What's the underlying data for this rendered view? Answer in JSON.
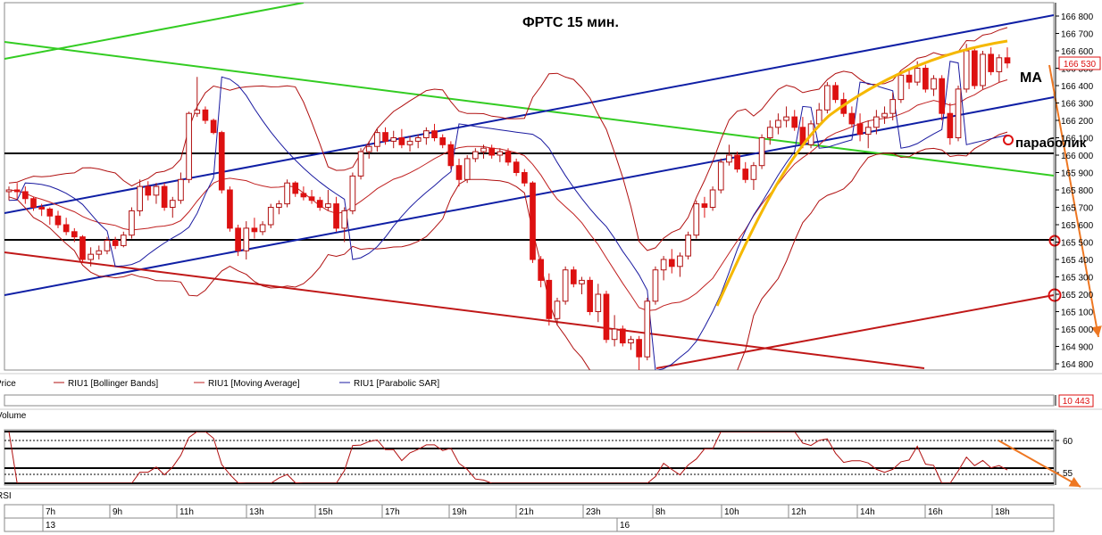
{
  "annotations": {
    "title": "ФРТС   15 мин.",
    "ma_label": "MA",
    "sar_label": "параболик"
  },
  "price_axis": {
    "ticks": [
      "166 800",
      "166 700",
      "166 600",
      "166 500",
      "166 400",
      "166 300",
      "166 200",
      "166 100",
      "166 000",
      "165 900",
      "165 800",
      "165 700",
      "165 600",
      "165 500",
      "165 400",
      "165 300",
      "165 200",
      "165 100",
      "165 000",
      "164 900",
      "164 800"
    ],
    "current_price": "166 530"
  },
  "legend": {
    "price": "Price",
    "bollinger": "RIU1 [Bollinger Bands]",
    "ma": "RIU1 [Moving Average]",
    "sar": "RIU1 [Parabolic SAR]"
  },
  "volume": {
    "label": "Volume",
    "value": "10 443"
  },
  "rsi": {
    "label": "RSI",
    "ticks": [
      "60",
      "55"
    ]
  },
  "time_axis": {
    "hours": [
      "7h",
      "9h",
      "11h",
      "13h",
      "15h",
      "17h",
      "19h",
      "21h",
      "23h",
      "8h",
      "10h",
      "12h",
      "14h",
      "16h",
      "18h"
    ],
    "days": [
      "13",
      "16"
    ]
  },
  "colors": {
    "bull_candle": "#ffffff",
    "bear_candle": "#dd1111",
    "bollinger": "#b01010",
    "moving_average": "#c02020",
    "parabolic_sar": "#1a1aa0",
    "channel_blue": "#0f1fa5",
    "trend_green": "#33cc22",
    "trend_red": "#c01818",
    "forecast_orange": "#ee7722",
    "ma_arc": "#f5b800"
  },
  "chart_data": {
    "type": "candlestick",
    "instrument": "RIU1",
    "timeframe": "15 мин.",
    "ylim": [
      164750,
      166870
    ],
    "candles": [
      {
        "o": 165790,
        "h": 165820,
        "l": 165740,
        "c": 165800
      },
      {
        "o": 165800,
        "h": 165840,
        "l": 165750,
        "c": 165790
      },
      {
        "o": 165790,
        "h": 165820,
        "l": 165720,
        "c": 165750
      },
      {
        "o": 165750,
        "h": 165760,
        "l": 165680,
        "c": 165700
      },
      {
        "o": 165700,
        "h": 165720,
        "l": 165650,
        "c": 165690
      },
      {
        "o": 165690,
        "h": 165700,
        "l": 165600,
        "c": 165650
      },
      {
        "o": 165650,
        "h": 165680,
        "l": 165580,
        "c": 165600
      },
      {
        "o": 165600,
        "h": 165640,
        "l": 165540,
        "c": 165560
      },
      {
        "o": 165560,
        "h": 165580,
        "l": 165500,
        "c": 165530
      },
      {
        "o": 165530,
        "h": 165540,
        "l": 165380,
        "c": 165400
      },
      {
        "o": 165400,
        "h": 165470,
        "l": 165360,
        "c": 165430
      },
      {
        "o": 165430,
        "h": 165480,
        "l": 165400,
        "c": 165450
      },
      {
        "o": 165450,
        "h": 165530,
        "l": 165430,
        "c": 165510
      },
      {
        "o": 165510,
        "h": 165530,
        "l": 165460,
        "c": 165480
      },
      {
        "o": 165480,
        "h": 165560,
        "l": 165470,
        "c": 165540
      },
      {
        "o": 165540,
        "h": 165700,
        "l": 165520,
        "c": 165680
      },
      {
        "o": 165680,
        "h": 165860,
        "l": 165650,
        "c": 165820
      },
      {
        "o": 165820,
        "h": 165850,
        "l": 165740,
        "c": 165770
      },
      {
        "o": 165770,
        "h": 165840,
        "l": 165720,
        "c": 165820
      },
      {
        "o": 165820,
        "h": 165840,
        "l": 165680,
        "c": 165700
      },
      {
        "o": 165700,
        "h": 165760,
        "l": 165640,
        "c": 165740
      },
      {
        "o": 165740,
        "h": 165900,
        "l": 165720,
        "c": 165860
      },
      {
        "o": 165860,
        "h": 166250,
        "l": 165840,
        "c": 166240
      },
      {
        "o": 166240,
        "h": 166450,
        "l": 166220,
        "c": 166260
      },
      {
        "o": 166260,
        "h": 166280,
        "l": 166180,
        "c": 166200
      },
      {
        "o": 166200,
        "h": 166210,
        "l": 166120,
        "c": 166130
      },
      {
        "o": 166130,
        "h": 166140,
        "l": 165780,
        "c": 165800
      },
      {
        "o": 165800,
        "h": 165820,
        "l": 165560,
        "c": 165580
      },
      {
        "o": 165580,
        "h": 165600,
        "l": 165420,
        "c": 165450
      },
      {
        "o": 165450,
        "h": 165620,
        "l": 165400,
        "c": 165580
      },
      {
        "o": 165580,
        "h": 165640,
        "l": 165520,
        "c": 165560
      },
      {
        "o": 165560,
        "h": 165620,
        "l": 165540,
        "c": 165600
      },
      {
        "o": 165600,
        "h": 165720,
        "l": 165580,
        "c": 165700
      },
      {
        "o": 165700,
        "h": 165740,
        "l": 165660,
        "c": 165720
      },
      {
        "o": 165720,
        "h": 165860,
        "l": 165700,
        "c": 165840
      },
      {
        "o": 165840,
        "h": 165850,
        "l": 165760,
        "c": 165780
      },
      {
        "o": 165780,
        "h": 165820,
        "l": 165740,
        "c": 165760
      },
      {
        "o": 165760,
        "h": 165800,
        "l": 165720,
        "c": 165740
      },
      {
        "o": 165740,
        "h": 165760,
        "l": 165680,
        "c": 165700
      },
      {
        "o": 165700,
        "h": 165800,
        "l": 165680,
        "c": 165720
      },
      {
        "o": 165720,
        "h": 165760,
        "l": 165560,
        "c": 165580
      },
      {
        "o": 165580,
        "h": 165700,
        "l": 165500,
        "c": 165680
      },
      {
        "o": 165680,
        "h": 165900,
        "l": 165660,
        "c": 165880
      },
      {
        "o": 165880,
        "h": 166040,
        "l": 165860,
        "c": 166020
      },
      {
        "o": 166020,
        "h": 166080,
        "l": 165980,
        "c": 166050
      },
      {
        "o": 166050,
        "h": 166150,
        "l": 166020,
        "c": 166130
      },
      {
        "o": 166130,
        "h": 166160,
        "l": 166060,
        "c": 166080
      },
      {
        "o": 166080,
        "h": 166140,
        "l": 166040,
        "c": 166100
      },
      {
        "o": 166100,
        "h": 166150,
        "l": 166040,
        "c": 166060
      },
      {
        "o": 166060,
        "h": 166110,
        "l": 166020,
        "c": 166080
      },
      {
        "o": 166080,
        "h": 166120,
        "l": 166040,
        "c": 166100
      },
      {
        "o": 166100,
        "h": 166160,
        "l": 166060,
        "c": 166140
      },
      {
        "o": 166140,
        "h": 166180,
        "l": 166080,
        "c": 166100
      },
      {
        "o": 166100,
        "h": 166120,
        "l": 166040,
        "c": 166060
      },
      {
        "o": 166060,
        "h": 166080,
        "l": 165920,
        "c": 165940
      },
      {
        "o": 165940,
        "h": 165980,
        "l": 165820,
        "c": 165860
      },
      {
        "o": 165860,
        "h": 166000,
        "l": 165840,
        "c": 165980
      },
      {
        "o": 165980,
        "h": 166040,
        "l": 165960,
        "c": 166020
      },
      {
        "o": 166020,
        "h": 166060,
        "l": 165980,
        "c": 166040
      },
      {
        "o": 166040,
        "h": 166060,
        "l": 165980,
        "c": 166000
      },
      {
        "o": 166000,
        "h": 166040,
        "l": 165960,
        "c": 166020
      },
      {
        "o": 166020,
        "h": 166040,
        "l": 165940,
        "c": 165960
      },
      {
        "o": 165960,
        "h": 165980,
        "l": 165880,
        "c": 165900
      },
      {
        "o": 165900,
        "h": 165920,
        "l": 165820,
        "c": 165840
      },
      {
        "o": 165840,
        "h": 165850,
        "l": 165380,
        "c": 165400
      },
      {
        "o": 165400,
        "h": 165420,
        "l": 165240,
        "c": 165280
      },
      {
        "o": 165280,
        "h": 165320,
        "l": 165020,
        "c": 165060
      },
      {
        "o": 165060,
        "h": 165180,
        "l": 165020,
        "c": 165160
      },
      {
        "o": 165160,
        "h": 165360,
        "l": 165140,
        "c": 165340
      },
      {
        "o": 165340,
        "h": 165360,
        "l": 165240,
        "c": 165260
      },
      {
        "o": 165260,
        "h": 165300,
        "l": 165200,
        "c": 165280
      },
      {
        "o": 165280,
        "h": 165300,
        "l": 165080,
        "c": 165100
      },
      {
        "o": 165100,
        "h": 165260,
        "l": 165040,
        "c": 165200
      },
      {
        "o": 165200,
        "h": 165220,
        "l": 164920,
        "c": 164940
      },
      {
        "o": 164940,
        "h": 165080,
        "l": 164900,
        "c": 165000
      },
      {
        "o": 165000,
        "h": 165020,
        "l": 164900,
        "c": 164920
      },
      {
        "o": 164920,
        "h": 164960,
        "l": 164880,
        "c": 164940
      },
      {
        "o": 164940,
        "h": 164960,
        "l": 164760,
        "c": 164840
      },
      {
        "o": 164840,
        "h": 165180,
        "l": 164820,
        "c": 165160
      },
      {
        "o": 165160,
        "h": 165360,
        "l": 165140,
        "c": 165340
      },
      {
        "o": 165340,
        "h": 165420,
        "l": 165280,
        "c": 165400
      },
      {
        "o": 165400,
        "h": 165460,
        "l": 165320,
        "c": 165360
      },
      {
        "o": 165360,
        "h": 165440,
        "l": 165300,
        "c": 165420
      },
      {
        "o": 165420,
        "h": 165560,
        "l": 165400,
        "c": 165540
      },
      {
        "o": 165540,
        "h": 165740,
        "l": 165520,
        "c": 165720
      },
      {
        "o": 165720,
        "h": 165760,
        "l": 165640,
        "c": 165700
      },
      {
        "o": 165700,
        "h": 165820,
        "l": 165680,
        "c": 165800
      },
      {
        "o": 165800,
        "h": 165980,
        "l": 165780,
        "c": 165960
      },
      {
        "o": 165960,
        "h": 166060,
        "l": 165940,
        "c": 166000
      },
      {
        "o": 166000,
        "h": 166020,
        "l": 165900,
        "c": 165920
      },
      {
        "o": 165920,
        "h": 165960,
        "l": 165840,
        "c": 165860
      },
      {
        "o": 165860,
        "h": 165960,
        "l": 165800,
        "c": 165940
      },
      {
        "o": 165940,
        "h": 166120,
        "l": 165920,
        "c": 166100
      },
      {
        "o": 166100,
        "h": 166200,
        "l": 166060,
        "c": 166160
      },
      {
        "o": 166160,
        "h": 166240,
        "l": 166120,
        "c": 166200
      },
      {
        "o": 166200,
        "h": 166280,
        "l": 166160,
        "c": 166220
      },
      {
        "o": 166220,
        "h": 166260,
        "l": 166140,
        "c": 166160
      },
      {
        "o": 166160,
        "h": 166220,
        "l": 166040,
        "c": 166060
      },
      {
        "o": 166060,
        "h": 166200,
        "l": 166040,
        "c": 166180
      },
      {
        "o": 166180,
        "h": 166300,
        "l": 166160,
        "c": 166260
      },
      {
        "o": 166260,
        "h": 166420,
        "l": 166240,
        "c": 166400
      },
      {
        "o": 166400,
        "h": 166420,
        "l": 166300,
        "c": 166320
      },
      {
        "o": 166320,
        "h": 166360,
        "l": 166220,
        "c": 166240
      },
      {
        "o": 166240,
        "h": 166280,
        "l": 166160,
        "c": 166180
      },
      {
        "o": 166180,
        "h": 166240,
        "l": 166080,
        "c": 166120
      },
      {
        "o": 166120,
        "h": 166200,
        "l": 166040,
        "c": 166160
      },
      {
        "o": 166160,
        "h": 166260,
        "l": 166120,
        "c": 166220
      },
      {
        "o": 166220,
        "h": 166280,
        "l": 166180,
        "c": 166240
      },
      {
        "o": 166240,
        "h": 166360,
        "l": 166200,
        "c": 166320
      },
      {
        "o": 166320,
        "h": 166480,
        "l": 166300,
        "c": 166460
      },
      {
        "o": 166460,
        "h": 166500,
        "l": 166380,
        "c": 166420
      },
      {
        "o": 166420,
        "h": 166540,
        "l": 166400,
        "c": 166500
      },
      {
        "o": 166500,
        "h": 166520,
        "l": 166360,
        "c": 166380
      },
      {
        "o": 166380,
        "h": 166460,
        "l": 166340,
        "c": 166440
      },
      {
        "o": 166440,
        "h": 166460,
        "l": 166200,
        "c": 166240
      },
      {
        "o": 166240,
        "h": 166300,
        "l": 166060,
        "c": 166100
      },
      {
        "o": 166100,
        "h": 166400,
        "l": 166080,
        "c": 166380
      },
      {
        "o": 166380,
        "h": 166640,
        "l": 166360,
        "c": 166600
      },
      {
        "o": 166600,
        "h": 166620,
        "l": 166380,
        "c": 166400
      },
      {
        "o": 166400,
        "h": 166600,
        "l": 166380,
        "c": 166580
      },
      {
        "o": 166580,
        "h": 166620,
        "l": 166460,
        "c": 166480
      },
      {
        "o": 166480,
        "h": 166580,
        "l": 166420,
        "c": 166560
      },
      {
        "o": 166560,
        "h": 166620,
        "l": 166500,
        "c": 166530
      }
    ],
    "horizontal_levels": [
      166000,
      165500
    ],
    "rsi_levels": [
      60,
      55
    ]
  }
}
